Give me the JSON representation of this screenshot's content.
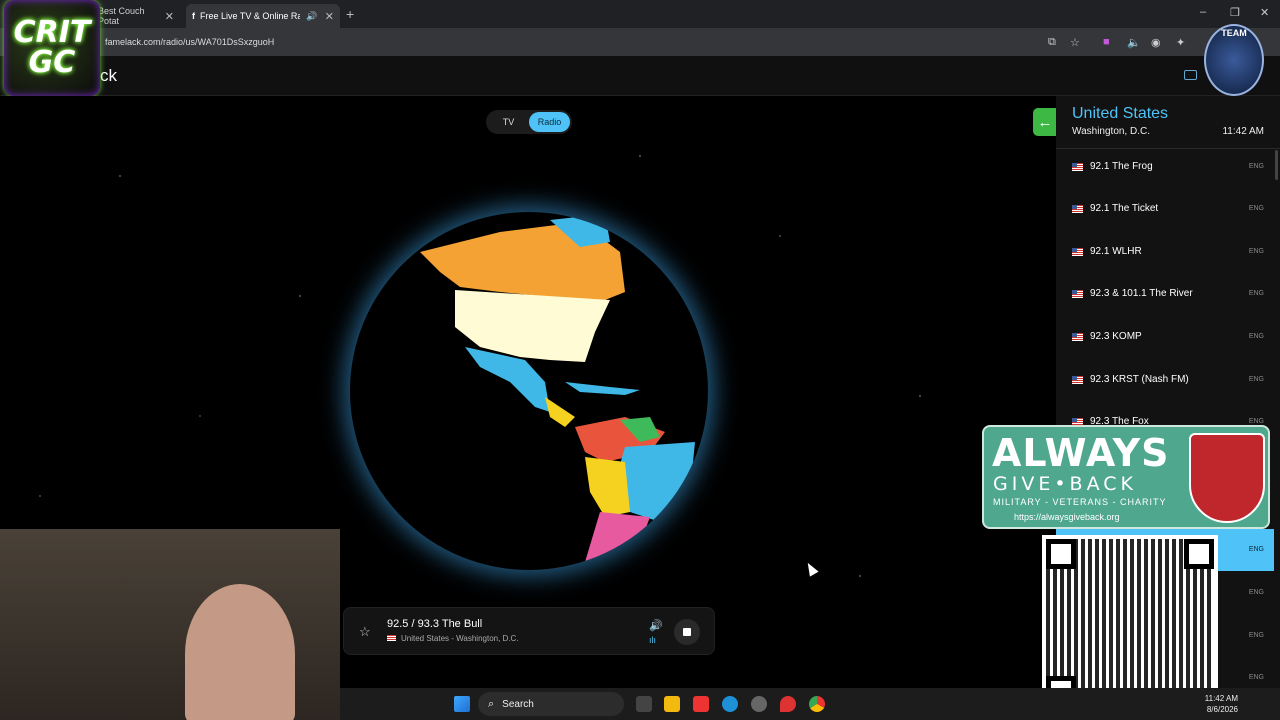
{
  "browser": {
    "tabs": [
      {
        "title": "Best Couch Potat"
      },
      {
        "title": "Free Live TV & Online Radio"
      }
    ],
    "url": "famelack.com/radio/us/WA701DsSxzguoH"
  },
  "site": {
    "title": "ck"
  },
  "overlay_logo": {
    "line1": "CRIT",
    "line2": "GC"
  },
  "team_badge": "TEAM",
  "mode_toggle": {
    "tv": "TV",
    "radio": "Radio"
  },
  "player": {
    "station": "92.5 / 93.3 The Bull",
    "location": "United States - Washington, D.C."
  },
  "panel": {
    "country": "United States",
    "city": "Washington, D.C.",
    "time": "11:42 AM",
    "stations": [
      {
        "name": "92.1 The Frog",
        "lang": "ENG"
      },
      {
        "name": "92.1 The Ticket",
        "lang": "ENG"
      },
      {
        "name": "92.1 WLHR",
        "lang": "ENG"
      },
      {
        "name": "92.3 & 101.1 The River",
        "lang": "ENG"
      },
      {
        "name": "92.3 KOMP",
        "lang": "ENG"
      },
      {
        "name": "92.3 KRST (Nash FM)",
        "lang": "ENG"
      },
      {
        "name": "92.3 The Fox",
        "lang": "ENG"
      }
    ],
    "lower_langs": [
      "ENG",
      "ENG",
      "ENG",
      "ENG"
    ]
  },
  "banner": {
    "line1": "ALWAYS",
    "line2": "GIVE•BACK",
    "line3": "MILITARY - VETERANS - CHARITY",
    "url": "https://alwaysgiveback.org"
  },
  "taskbar": {
    "search_placeholder": "Search",
    "clock_time": "11:42 AM",
    "clock_date": "8/6/2026"
  },
  "colors": {
    "accent": "#4fc3f7",
    "back_button": "#3db845"
  }
}
